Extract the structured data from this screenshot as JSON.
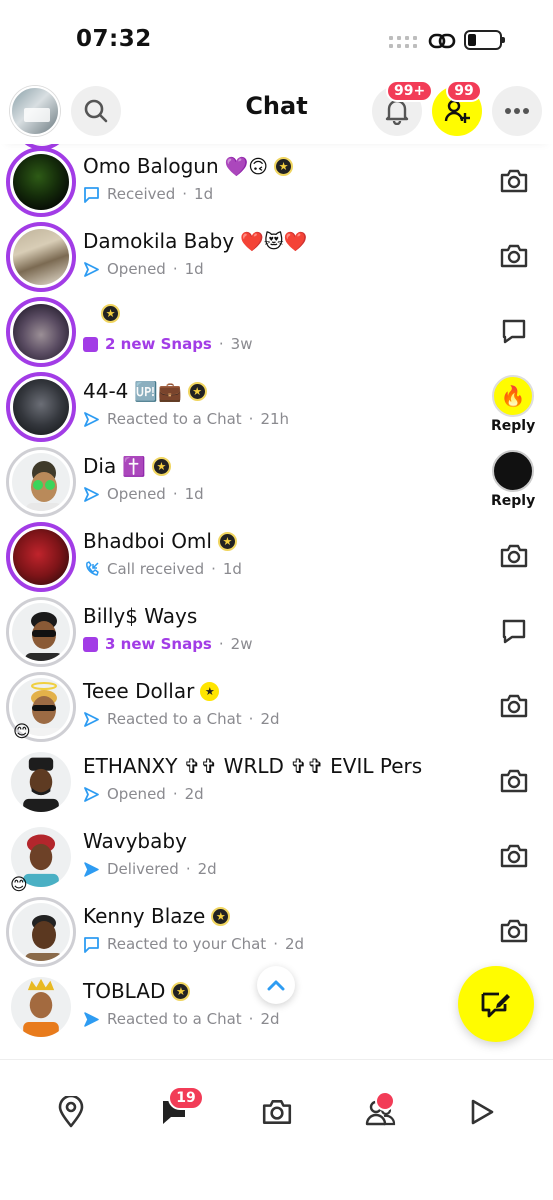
{
  "status_bar": {
    "time": "07:32"
  },
  "header": {
    "title": "Chat",
    "notifications_badge": "99+",
    "friend_requests_badge": "99"
  },
  "chats": [
    {
      "name": "Omo Balogun",
      "emoji": "💜🙃",
      "badge": "star",
      "status": "Received",
      "time": "1d",
      "status_icon": "received-chat-icon",
      "action": "camera-icon"
    },
    {
      "name": "Damokila Baby",
      "emoji": "❤️😻❤️",
      "badge": "",
      "status": "Opened",
      "time": "1d",
      "status_icon": "opened-arrow-icon",
      "action": "camera-icon"
    },
    {
      "name": "",
      "emoji": "",
      "badge": "star",
      "status": "2 new Snaps",
      "time": "3w",
      "status_icon": "new-snap-icon",
      "action": "chat-icon"
    },
    {
      "name": "44-4",
      "emoji": "🆙💼",
      "badge": "star",
      "status": "Reacted to a Chat",
      "time": "21h",
      "status_icon": "opened-arrow-icon",
      "action": "reply",
      "reply_label": "Reply",
      "reply_emoji": "🔥"
    },
    {
      "name": "Dia",
      "emoji": "✝️",
      "badge": "star",
      "status": "Opened",
      "time": "1d",
      "status_icon": "opened-arrow-icon",
      "action": "reply",
      "reply_label": "Reply",
      "reply_emoji": ""
    },
    {
      "name": "Bhadboi Oml",
      "emoji": "",
      "badge": "star",
      "status": "Call received",
      "time": "1d",
      "status_icon": "call-received-icon",
      "action": "camera-icon"
    },
    {
      "name": "Billy$ Ways",
      "emoji": "",
      "badge": "",
      "status": "3 new Snaps",
      "time": "2w",
      "status_icon": "new-snap-icon",
      "action": "chat-icon"
    },
    {
      "name": "Teee Dollar",
      "emoji": "",
      "badge": "gold-star",
      "status": "Reacted to a Chat",
      "time": "2d",
      "status_icon": "opened-arrow-icon",
      "action": "camera-icon",
      "avatar_emoji": "😊"
    },
    {
      "name": "ETHANXY ✞✞ WRLD ✞✞ EVIL Pers",
      "emoji": "",
      "badge": "",
      "status": "Opened",
      "time": "2d",
      "status_icon": "opened-arrow-icon",
      "action": "camera-icon"
    },
    {
      "name": "Wavybaby",
      "emoji": "",
      "badge": "",
      "status": "Delivered",
      "time": "2d",
      "status_icon": "delivered-arrow-icon",
      "action": "camera-icon",
      "avatar_emoji": "😊"
    },
    {
      "name": "Kenny Blaze",
      "emoji": "",
      "badge": "star",
      "status": "Reacted to your Chat",
      "time": "2d",
      "status_icon": "received-chat-icon",
      "action": "camera-icon"
    },
    {
      "name": "TOBLAD",
      "emoji": "",
      "badge": "star",
      "status": "Reacted to a Chat",
      "time": "2d",
      "status_icon": "delivered-arrow-icon",
      "action": "camera-icon"
    }
  ],
  "bottom_nav": {
    "chat_badge": "19"
  },
  "colors": {
    "snap_yellow": "#fffc00",
    "story_purple": "#a23ce6",
    "badge_red": "#f23c57",
    "chat_blue": "#2e9cf2"
  }
}
